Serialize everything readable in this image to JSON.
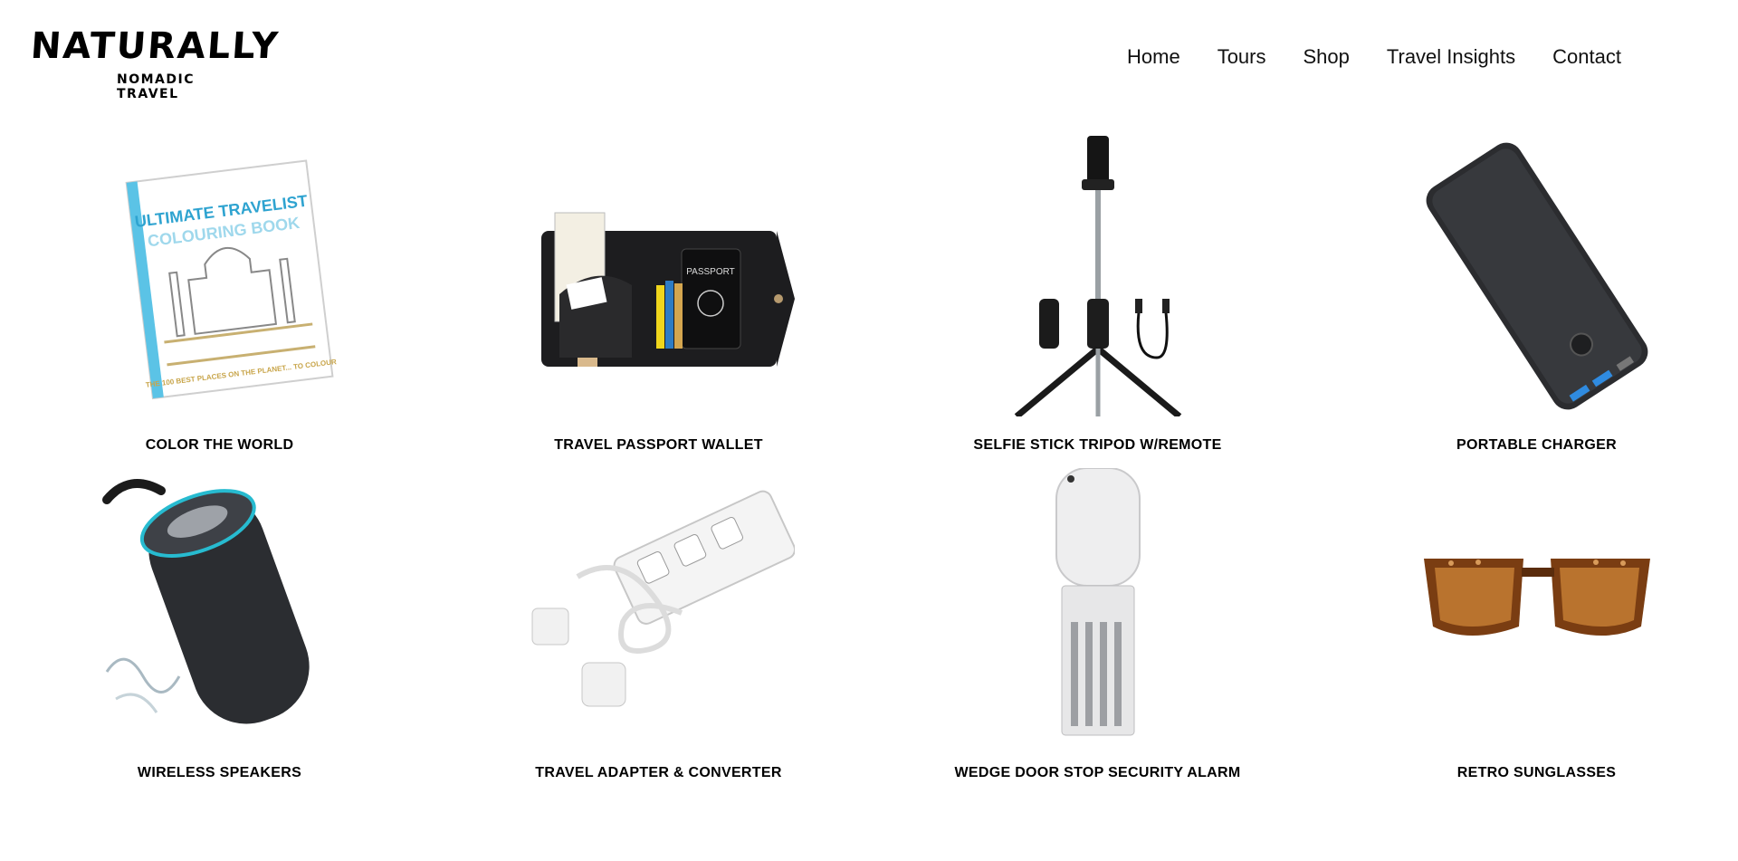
{
  "logo": {
    "main": "NATURALLY",
    "sub": "NOMADIC TRAVEL"
  },
  "nav": [
    "Home",
    "Tours",
    "Shop",
    "Travel Insights",
    "Contact"
  ],
  "products": [
    {
      "name": "COLOR THE WORLD",
      "image_icon": "colouring-book-icon",
      "cover_title": "ULTIMATE TRAVELIST",
      "cover_subtitle": "COLOURING BOOK",
      "cover_tagline": "THE 100 BEST PLACES ON THE PLANET... TO COLOUR"
    },
    {
      "name": "TRAVEL PASSPORT WALLET",
      "image_icon": "passport-wallet-icon",
      "passport_text": "PASSPORT"
    },
    {
      "name": "SELFIE STICK TRIPOD W/REMOTE",
      "image_icon": "selfie-stick-tripod-icon"
    },
    {
      "name": "PORTABLE CHARGER",
      "image_icon": "power-bank-icon"
    },
    {
      "name": "WIRELESS SPEAKERS",
      "image_icon": "wireless-speaker-icon"
    },
    {
      "name": "TRAVEL ADAPTER & CONVERTER",
      "image_icon": "travel-adapter-icon"
    },
    {
      "name": "WEDGE DOOR STOP SECURITY ALARM",
      "image_icon": "door-stop-alarm-icon"
    },
    {
      "name": "RETRO SUNGLASSES",
      "image_icon": "sunglasses-icon"
    }
  ]
}
